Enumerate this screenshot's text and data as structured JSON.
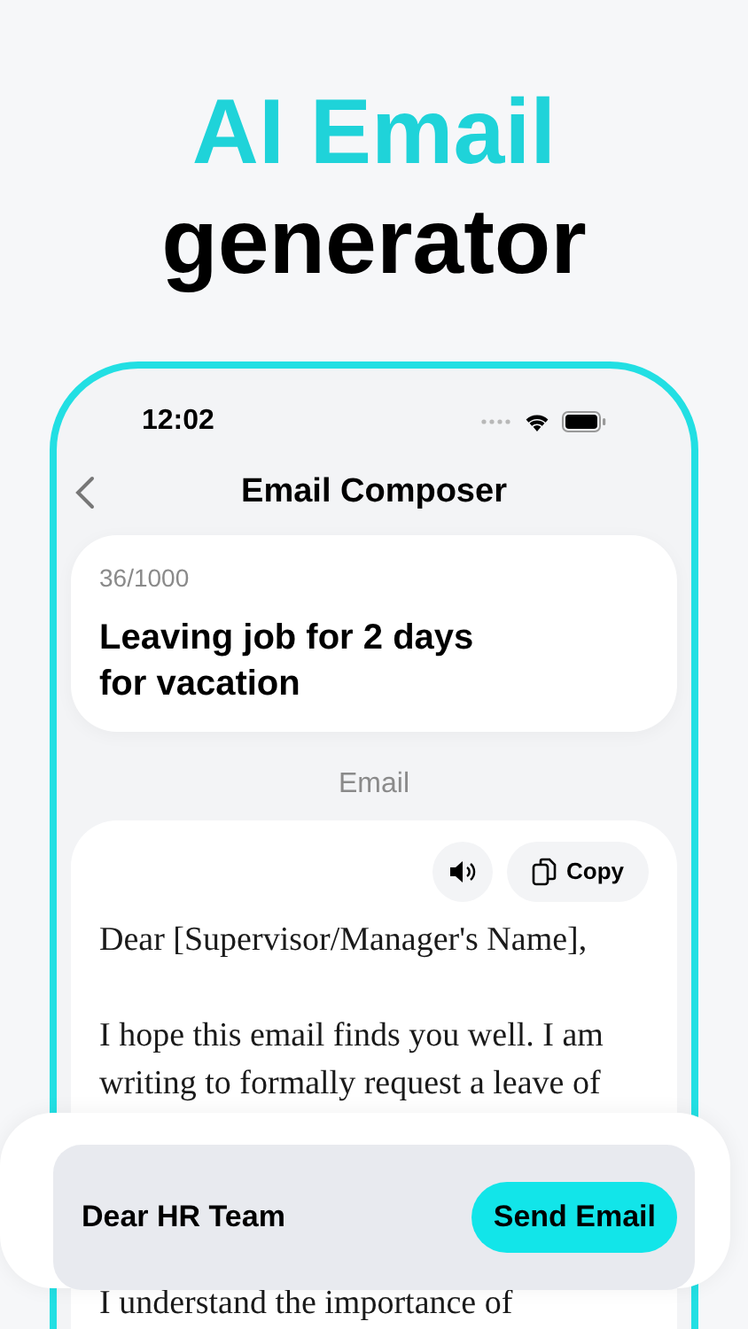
{
  "headline": {
    "accent": "AI Email",
    "rest": "generator"
  },
  "status_bar": {
    "time": "12:02"
  },
  "nav": {
    "title": "Email Composer"
  },
  "prompt": {
    "count": "36/1000",
    "text": "Leaving job for 2 days for vacation"
  },
  "section_label": "Email",
  "email": {
    "copy_label": "Copy",
    "lines": [
      "Dear [Supervisor/Manager's Name],",
      "I hope this email finds you well. I am writing to formally request a leave of",
      "I understand the importance of"
    ]
  },
  "composer": {
    "value": "Dear HR Team",
    "send_label": "Send Email"
  }
}
